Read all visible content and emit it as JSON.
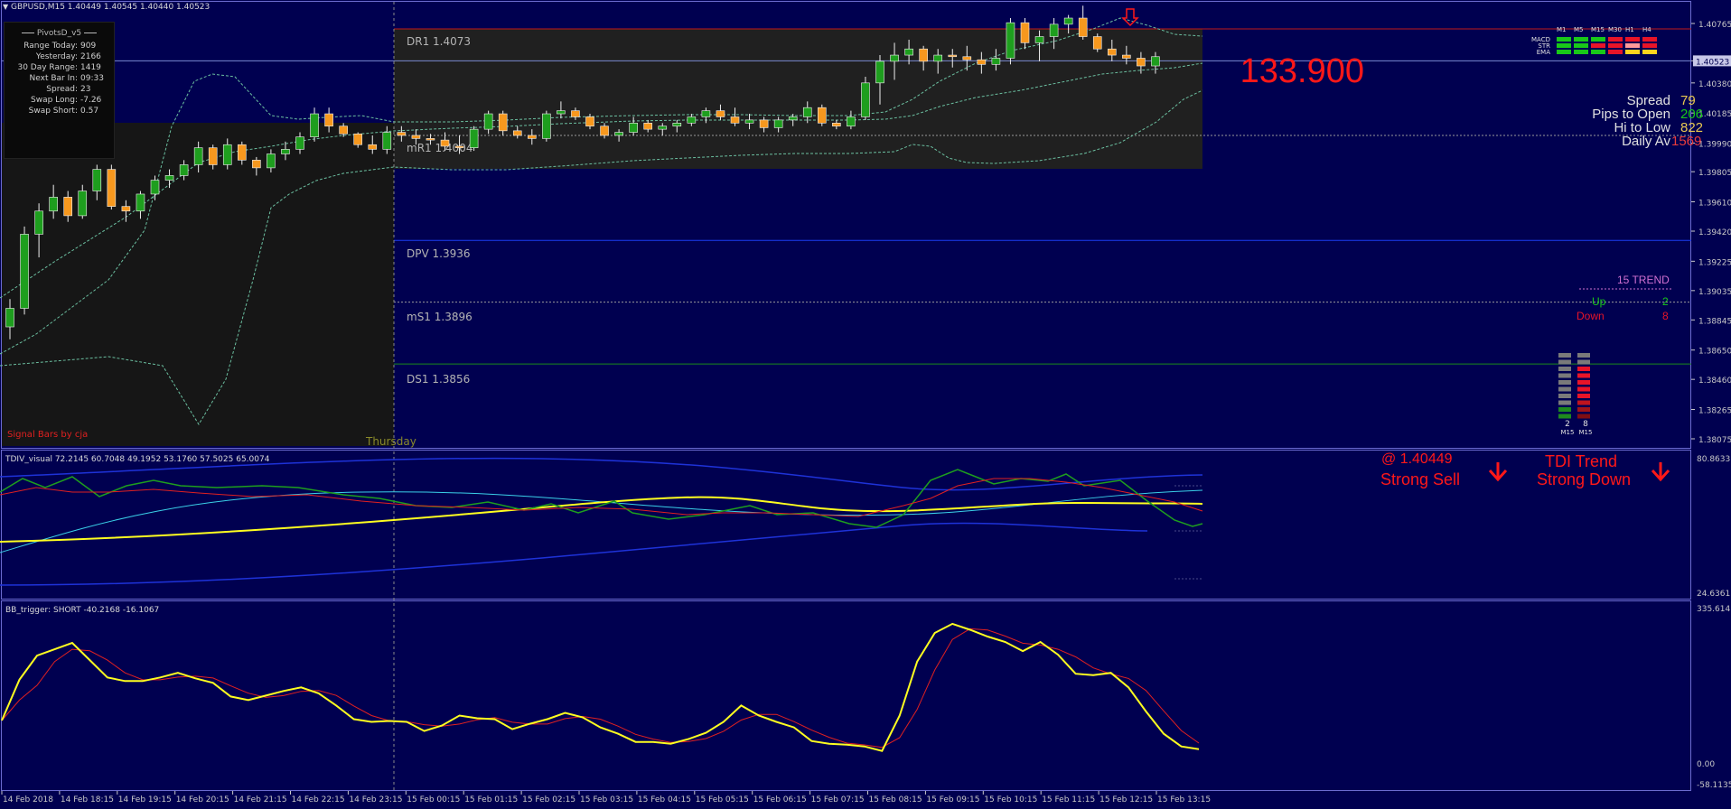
{
  "window": {
    "title_symbol": "GBPUSD,M15",
    "title_ohlc": "1.40449 1.40545 1.40440 1.40523"
  },
  "pivots_panel": {
    "title": "PivotsD_v5",
    "rows": [
      {
        "label": "Range  Today:",
        "value": "909"
      },
      {
        "label": "Yesterday:",
        "value": "2166"
      },
      {
        "label": "30 Day Range:",
        "value": "1419"
      },
      {
        "label": "Next Bar In:",
        "value": "09:33"
      },
      {
        "label": "Spread:",
        "value": "23"
      },
      {
        "label": "Swap  Long:",
        "value": "-7.26"
      },
      {
        "label": "Swap  Short:",
        "value": "0.57"
      }
    ]
  },
  "levels": {
    "dr1": {
      "name": "DR1",
      "value": "1.4073"
    },
    "mr1": {
      "name": "mR1",
      "value": "1.4004"
    },
    "dpv": {
      "name": "DPV",
      "value": "1.3936"
    },
    "ms1": {
      "name": "mS1",
      "value": "1.3896"
    },
    "ds1": {
      "name": "DS1",
      "value": "1.3856"
    }
  },
  "day_label": "Thursday",
  "signal_bars_label": "Signal Bars by cja",
  "price_axis": [
    "1.40765",
    "1.40523",
    "1.40380",
    "1.40185",
    "1.39990",
    "1.39805",
    "1.39610",
    "1.39420",
    "1.39225",
    "1.39035",
    "1.38845",
    "1.38650",
    "1.38460",
    "1.38265",
    "1.38075"
  ],
  "current_price": "1.40523",
  "signal_grid": {
    "timeframes": [
      "M1",
      "M5",
      "M15",
      "M30",
      "H1",
      "H4"
    ],
    "rows": [
      "MACD",
      "STR",
      "EMA"
    ],
    "colors": [
      [
        "#19c819",
        "#19c819",
        "#19c819",
        "#e81428",
        "#e81428",
        "#e81428"
      ],
      [
        "#19c819",
        "#19c819",
        "#e81428",
        "#e81428",
        "#ff9a9a",
        "#e81428"
      ],
      [
        "#19c819",
        "#19c819",
        "#19c819",
        "#e81428",
        "#ffd21e",
        "#ffd21e"
      ]
    ]
  },
  "stats": {
    "big_value": "133.900",
    "rows": [
      {
        "label": "Spread",
        "value": "79",
        "color": "#e8c850"
      },
      {
        "label": "Pips to Open",
        "value": "206",
        "color": "#19c819"
      },
      {
        "label": "Hi to Low",
        "value": "822",
        "color": "#e8c850"
      },
      {
        "label": "Daily Av",
        "value": "1569",
        "color": "#e83c3c"
      }
    ]
  },
  "trend": {
    "title": "15 TREND",
    "up_label": "Up",
    "up_value": "2",
    "down_label": "Down",
    "down_value": "8",
    "bar_labels": [
      "2",
      "8"
    ],
    "bar_tf": [
      "M15",
      "M15"
    ]
  },
  "tdi": {
    "title": "TDIV_visual 72.2145 60.7048 49.1952 53.1760 57.5025 65.0074",
    "axis_top": "80.8633",
    "axis_bottom": "24.6361",
    "signal_price": "@ 1.40449",
    "signal_text": "Strong Sell",
    "trend_title": "TDI Trend",
    "trend_text": "Strong Down"
  },
  "bb": {
    "title": "BB_trigger: SHORT -40.2168 -16.1067",
    "axis_top": "335.6141",
    "axis_zero": "0.00",
    "axis_bottom": "-58.1135"
  },
  "time_axis": [
    "14 Feb 2018",
    "14 Feb 18:15",
    "14 Feb 19:15",
    "14 Feb 20:15",
    "14 Feb 21:15",
    "14 Feb 22:15",
    "14 Feb 23:15",
    "15 Feb 00:15",
    "15 Feb 01:15",
    "15 Feb 02:15",
    "15 Feb 03:15",
    "15 Feb 04:15",
    "15 Feb 05:15",
    "15 Feb 06:15",
    "15 Feb 07:15",
    "15 Feb 08:15",
    "15 Feb 09:15",
    "15 Feb 10:15",
    "15 Feb 11:15",
    "15 Feb 12:15",
    "15 Feb 13:15"
  ],
  "colors": {
    "background": "#000050",
    "bull_candle": "#1e9e1e",
    "bear_candle": "#f7981e",
    "pivot_box": "#202020",
    "signal_red": "#ff1818"
  },
  "candles": [
    [
      1.388,
      1.3898,
      1.3872,
      1.3892
    ],
    [
      1.3892,
      1.3945,
      1.3888,
      1.394
    ],
    [
      1.394,
      1.396,
      1.3925,
      1.3955
    ],
    [
      1.3955,
      1.3972,
      1.395,
      1.3964
    ],
    [
      1.3964,
      1.3968,
      1.3948,
      1.3952
    ],
    [
      1.3952,
      1.3972,
      1.395,
      1.3968
    ],
    [
      1.3968,
      1.3985,
      1.3962,
      1.3982
    ],
    [
      1.3982,
      1.3985,
      1.3956,
      1.3958
    ],
    [
      1.3958,
      1.3962,
      1.3948,
      1.3955
    ],
    [
      1.3955,
      1.3968,
      1.395,
      1.3966
    ],
    [
      1.3966,
      1.3978,
      1.3962,
      1.3975
    ],
    [
      1.3975,
      1.3982,
      1.397,
      1.3978
    ],
    [
      1.3978,
      1.3988,
      1.3975,
      1.3985
    ],
    [
      1.3985,
      1.4,
      1.398,
      1.3996
    ],
    [
      1.3996,
      1.3998,
      1.3982,
      1.3985
    ],
    [
      1.3985,
      1.4002,
      1.3982,
      1.3998
    ],
    [
      1.3998,
      1.4,
      1.3985,
      1.3988
    ],
    [
      1.3988,
      1.399,
      1.3978,
      1.3983
    ],
    [
      1.3983,
      1.3995,
      1.398,
      1.3992
    ],
    [
      1.3992,
      1.4,
      1.3988,
      1.3995
    ],
    [
      1.3995,
      1.4006,
      1.3992,
      1.4003
    ],
    [
      1.4003,
      1.4022,
      1.4,
      1.4018
    ],
    [
      1.4018,
      1.4022,
      1.4006,
      1.401
    ],
    [
      1.401,
      1.4012,
      1.4003,
      1.4005
    ],
    [
      1.4005,
      1.4006,
      1.3996,
      1.3998
    ],
    [
      1.3998,
      1.4004,
      1.3992,
      1.3995
    ],
    [
      1.3995,
      1.401,
      1.3992,
      1.4006
    ],
    [
      1.4006,
      1.401,
      1.4,
      1.4004
    ],
    [
      1.4004,
      1.4008,
      1.3998,
      1.4002
    ],
    [
      1.4002,
      1.4005,
      1.3998,
      1.4001
    ],
    [
      1.4001,
      1.4006,
      1.3994,
      1.3997
    ],
    [
      1.3997,
      1.4004,
      1.3992,
      1.3996
    ],
    [
      1.3996,
      1.401,
      1.3994,
      1.4008
    ],
    [
      1.4008,
      1.402,
      1.4005,
      1.4018
    ],
    [
      1.4018,
      1.402,
      1.4004,
      1.4007
    ],
    [
      1.4007,
      1.401,
      1.4002,
      1.4004
    ],
    [
      1.4004,
      1.4008,
      1.3998,
      1.4002
    ],
    [
      1.4002,
      1.402,
      1.4,
      1.4018
    ],
    [
      1.4018,
      1.4026,
      1.4015,
      1.402
    ],
    [
      1.402,
      1.4022,
      1.4014,
      1.4016
    ],
    [
      1.4016,
      1.4018,
      1.4008,
      1.401
    ],
    [
      1.401,
      1.4012,
      1.4002,
      1.4004
    ],
    [
      1.4004,
      1.4008,
      1.4,
      1.4006
    ],
    [
      1.4006,
      1.4016,
      1.4004,
      1.4012
    ],
    [
      1.4012,
      1.4014,
      1.4006,
      1.4008
    ],
    [
      1.4008,
      1.4012,
      1.4004,
      1.401
    ],
    [
      1.401,
      1.4014,
      1.4006,
      1.4012
    ],
    [
      1.4012,
      1.4018,
      1.401,
      1.4016
    ],
    [
      1.4016,
      1.4022,
      1.4012,
      1.402
    ],
    [
      1.402,
      1.4024,
      1.4014,
      1.4016
    ],
    [
      1.4016,
      1.4022,
      1.401,
      1.4012
    ],
    [
      1.4012,
      1.4018,
      1.4008,
      1.4014
    ],
    [
      1.4014,
      1.4016,
      1.4006,
      1.4009
    ],
    [
      1.4009,
      1.4016,
      1.4006,
      1.4014
    ],
    [
      1.4014,
      1.4018,
      1.401,
      1.4016
    ],
    [
      1.4016,
      1.4026,
      1.4012,
      1.4022
    ],
    [
      1.4022,
      1.4024,
      1.401,
      1.4012
    ],
    [
      1.4012,
      1.4014,
      1.4008,
      1.401
    ],
    [
      1.401,
      1.402,
      1.4008,
      1.4016
    ],
    [
      1.4016,
      1.4042,
      1.4014,
      1.4038
    ],
    [
      1.4038,
      1.4056,
      1.4024,
      1.4052
    ],
    [
      1.4052,
      1.4064,
      1.404,
      1.4056
    ],
    [
      1.4056,
      1.4066,
      1.405,
      1.406
    ],
    [
      1.406,
      1.4062,
      1.4046,
      1.4052
    ],
    [
      1.4052,
      1.406,
      1.4044,
      1.4056
    ],
    [
      1.4056,
      1.406,
      1.4048,
      1.4055
    ],
    [
      1.4055,
      1.4062,
      1.4046,
      1.4053
    ],
    [
      1.4053,
      1.4058,
      1.4044,
      1.405
    ],
    [
      1.405,
      1.406,
      1.4046,
      1.4054
    ],
    [
      1.4054,
      1.408,
      1.405,
      1.4077
    ],
    [
      1.4077,
      1.408,
      1.406,
      1.4064
    ],
    [
      1.4064,
      1.4072,
      1.4052,
      1.4068
    ],
    [
      1.4068,
      1.408,
      1.406,
      1.4076
    ],
    [
      1.4076,
      1.4082,
      1.407,
      1.408
    ],
    [
      1.408,
      1.4088,
      1.4066,
      1.4068
    ],
    [
      1.4068,
      1.407,
      1.4058,
      1.406
    ],
    [
      1.406,
      1.4066,
      1.4052,
      1.4056
    ],
    [
      1.4056,
      1.4062,
      1.405,
      1.4054
    ],
    [
      1.4054,
      1.4058,
      1.4044,
      1.4049
    ],
    [
      1.4049,
      1.4058,
      1.4044,
      1.4055
    ]
  ],
  "bb_values": [
    85,
    175,
    228,
    242,
    256,
    218,
    180,
    172,
    172,
    180,
    190,
    178,
    168,
    138,
    130,
    140,
    150,
    158,
    145,
    118,
    88,
    82,
    84,
    82,
    62,
    74,
    96,
    90,
    88,
    66,
    78,
    88,
    102,
    92,
    70,
    56,
    38,
    38,
    34,
    44,
    58,
    82,
    118,
    96,
    82,
    70,
    40,
    34,
    32,
    28,
    18,
    96,
    215,
    278,
    298,
    285,
    270,
    258,
    238,
    258,
    230,
    188,
    185,
    190,
    158,
    105,
    56,
    28,
    22
  ]
}
